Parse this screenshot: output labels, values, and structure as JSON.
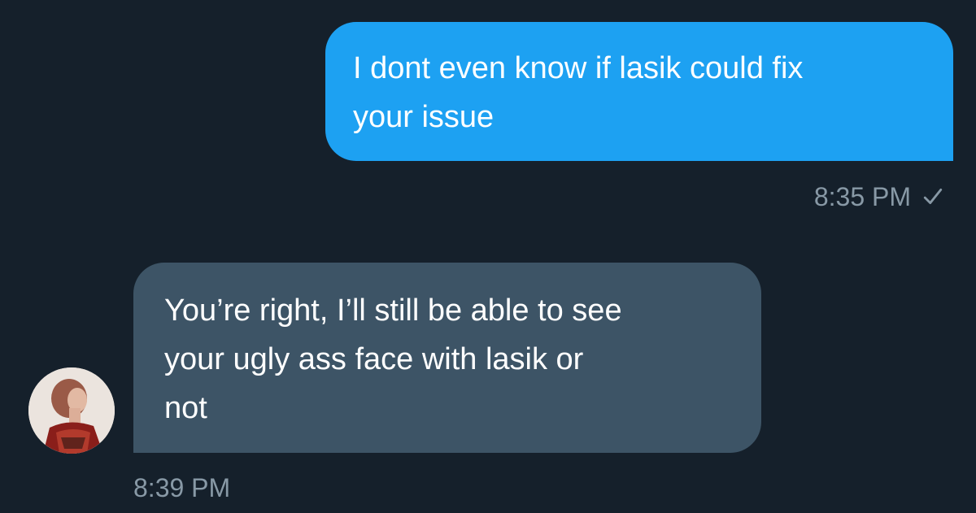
{
  "conversation": {
    "messages": [
      {
        "direction": "outgoing",
        "lines": [
          "I dont even know if lasik could fix",
          "your issue"
        ],
        "time": "8:35 PM",
        "status_icon": "check-icon"
      },
      {
        "direction": "incoming",
        "lines": [
          "You’re right, I’ll still be able to see",
          "your ugly ass face with lasik or",
          "not"
        ],
        "time": "8:39 PM",
        "avatar_icon": "avatar-image"
      }
    ]
  },
  "colors": {
    "background": "#15202b",
    "outgoing_bubble": "#1da1f2",
    "incoming_bubble": "#3d5466",
    "timestamp": "#8899a6"
  }
}
